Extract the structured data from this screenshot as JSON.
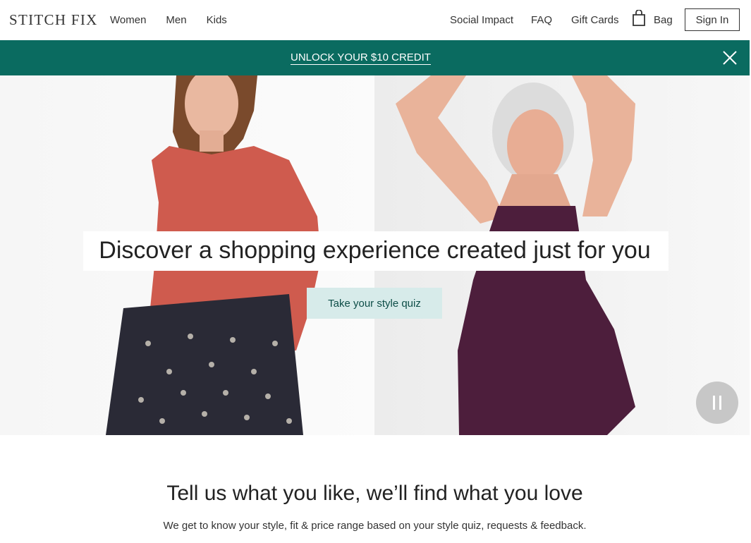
{
  "header": {
    "logo": "STITCH FIX",
    "nav_left": [
      "Women",
      "Men",
      "Kids"
    ],
    "social_impact": "Social Impact",
    "faq": "FAQ",
    "gift_cards": "Gift Cards",
    "bag": "Bag",
    "sign_in": "Sign In"
  },
  "promo": {
    "text": "UNLOCK YOUR $10 CREDIT",
    "color": "#0a6b60"
  },
  "hero": {
    "headline": "Discover a shopping experience created just for you",
    "cta": "Take your style quiz"
  },
  "section": {
    "title": "Tell us what you like, we’ll find what you love",
    "subtitle": "We get to know your style, fit & price range based on your style quiz, requests & feedback."
  }
}
